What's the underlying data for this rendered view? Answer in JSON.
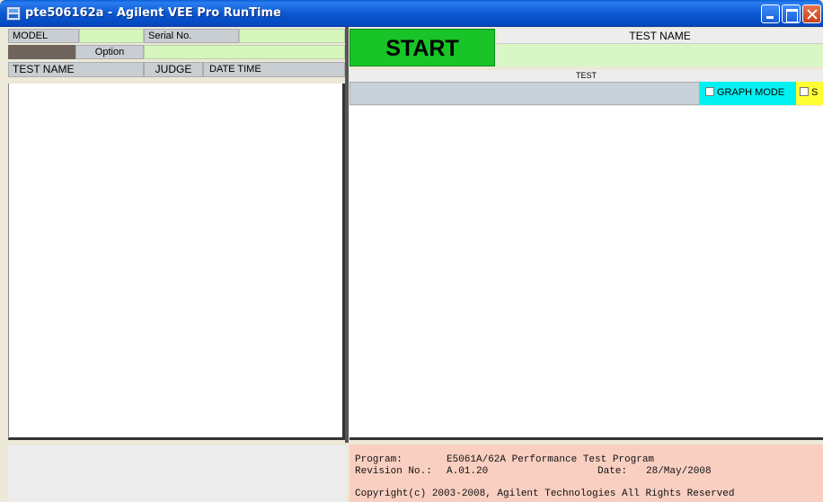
{
  "window": {
    "title": "pte506162a - Agilent VEE Pro RunTime"
  },
  "left_panel": {
    "model_label": "MODEL",
    "option_label": "Option",
    "serial_label": "Serial No.",
    "columns": {
      "test_name": "TEST NAME",
      "judge": "JUDGE",
      "date_time": "DATE TIME"
    }
  },
  "right_panel": {
    "start_label": "START",
    "test_name_header": "TEST NAME",
    "test_header": "TEST",
    "graph_mode_label": "GRAPH MODE",
    "s_label": "S"
  },
  "info": {
    "program_label": "Program:",
    "program_value": "E5061A/62A Performance Test Program",
    "revision_label": "Revision No.:",
    "revision_value": "A.01.20",
    "date_label": "Date:",
    "date_value": "28/May/2008",
    "copyright": "Copyright(c) 2003-2008, Agilent Technologies All Rights Reserved"
  },
  "colors": {
    "title_bar": "#0b58d2",
    "start_green": "#18c427",
    "field_green": "#d6f6bd",
    "graph_cyan": "#00f1f1",
    "s_yellow": "#ffff33",
    "info_pink": "#f9cfc1"
  }
}
